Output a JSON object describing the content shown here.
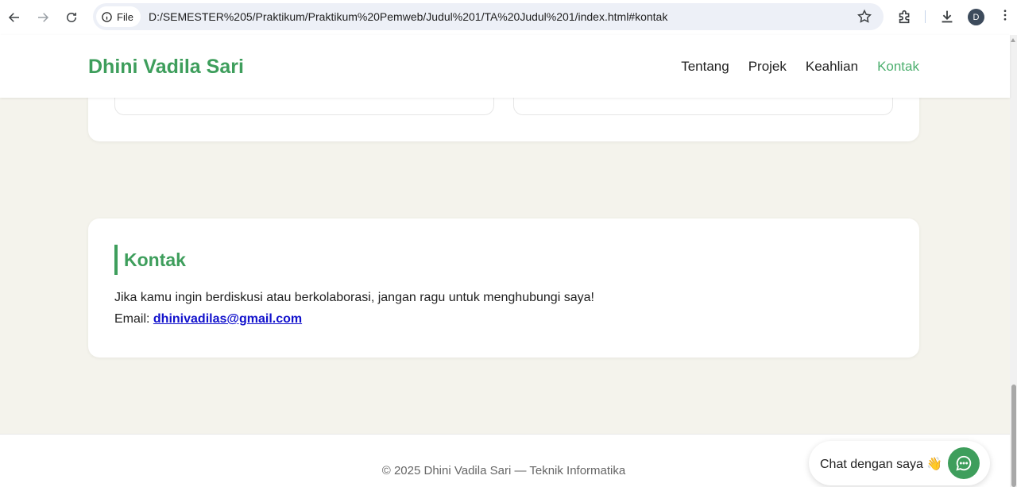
{
  "browser": {
    "file_label": "File",
    "url": "D:/SEMESTER%205/Praktikum/Praktikum%20Pemweb/Judul%201/TA%20Judul%201/index.html#kontak",
    "avatar_letter": "D"
  },
  "header": {
    "brand": "Dhini Vadila Sari",
    "nav": [
      "Tentang",
      "Projek",
      "Keahlian",
      "Kontak"
    ],
    "active_nav": "Kontak"
  },
  "contact": {
    "title": "Kontak",
    "description": "Jika kamu ingin berdiskusi atau berkolaborasi, jangan ragu untuk menghubungi saya!",
    "email_label": "Email:",
    "email": "dhinivadilas@gmail.com"
  },
  "footer": {
    "text": "© 2025 Dhini Vadila Sari — Teknik Informatika"
  },
  "chat": {
    "label": "Chat dengan saya 👋"
  },
  "colors": {
    "accent": "#3e9e5c",
    "background": "#f4f3ec",
    "link": "#1111cc"
  }
}
